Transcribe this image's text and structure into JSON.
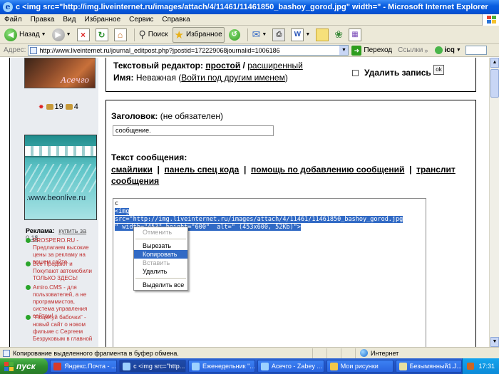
{
  "window": {
    "title": "c <img src=\"http://img.liveinternet.ru/images/attach/4/11461/11461850_bashoy_gorod.jpg\" width=\" - Microsoft Internet Explorer"
  },
  "menu": [
    "Файл",
    "Правка",
    "Вид",
    "Избранное",
    "Сервис",
    "Справка"
  ],
  "toolbar": {
    "back_label": "Назад",
    "search_label": "Поиск",
    "favorites_label": "Избранное"
  },
  "address": {
    "label": "Адрес:",
    "url": "http://www.liveinternet.ru/journal_editpost.php?jpostid=172229068journalid=1006186",
    "go_label": "Переход",
    "links_label": "Ссылки",
    "icq_label": "icq"
  },
  "sidebar": {
    "avatar_signature": "Асечго",
    "rating_a": "19",
    "rating_b": "4",
    "banner_text": ".www.beonlive.ru",
    "ads_title": "Реклама:",
    "ads_buy": "купить за 0.1$",
    "ads": [
      {
        "text": "PROSPERO.RU - Предлагаем высокие цены за рекламу на вашем сайте."
      },
      {
        "text": "Все Продают и Покупают автомобили ТОЛЬКО ЗДЕСЬ!"
      },
      {
        "text": "Amiro.CMS - для пользователей, а не программистов, система управления сайтом!"
      },
      {
        "text": "\"Поцелуй бабочки\" - новый сайт о новом фильме с Сергеем Безруковым в главной ..."
      }
    ]
  },
  "editor": {
    "editor_label": "Текстовый редактор",
    "simple": "простой",
    "advanced": "расширенный",
    "name_label": "Имя",
    "name_value": "Неважная",
    "login_other": "Войти под другим именем",
    "delete_label": "Удалить запись",
    "ok_label": "ok",
    "title_label": "Заголовок",
    "title_optional": "(не обязателен)",
    "title_value": "сообщение.",
    "text_label": "Текст сообщения",
    "link_smileys": "смайлики",
    "link_panel": "панель спец кода",
    "link_help": "помощь по добавлению сообщений",
    "link_translit": "транслит",
    "link_messages": "сообщения",
    "content_line1": "с",
    "content_line2": "<img",
    "content_line3": "src=\"http://img.liveinternet.ru/images/attach/4/11461/11461850_bashoy_gorod.jpg",
    "content_line4": "\" width=\"453\" height=\"600\"  alt=\" (453x600, 52Kb)\">"
  },
  "context_menu": {
    "undo": "Отменить",
    "cut": "Вырезать",
    "copy": "Копировать",
    "paste": "Вставить",
    "delete": "Удалить",
    "select_all": "Выделить все"
  },
  "status": {
    "text": "Копирование выделенного фрагмента в буфер обмена.",
    "zone": "Интернет"
  },
  "taskbar": {
    "start_label": "пуск",
    "tasks": [
      {
        "label": "Яндекс.Почта - ..."
      },
      {
        "label": "с <img src=\"http..."
      },
      {
        "label": "Еженедельник \"..."
      },
      {
        "label": "Асечго - Zabey ..."
      },
      {
        "label": "Мои рисунки"
      },
      {
        "label": "Безымянный1.J..."
      }
    ],
    "time": "17:31"
  },
  "colors": {
    "selection": "#316ac5",
    "titlebar": "#0a5ee0",
    "taskbar": "#2457c8",
    "start": "#2e8f2e"
  }
}
